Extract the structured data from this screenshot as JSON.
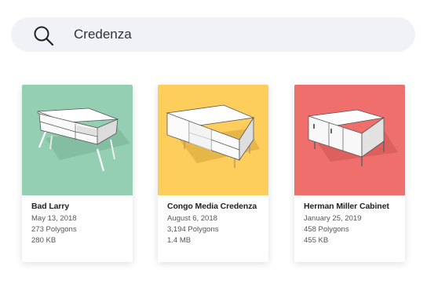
{
  "search": {
    "query": "Credenza",
    "icon": "search-icon"
  },
  "colors": {
    "search_bg": "#f1f2f6",
    "card1_thumb": "#94cfb3",
    "card2_thumb": "#fece5d",
    "card3_thumb": "#ef6f6d"
  },
  "results": [
    {
      "title": "Bad Larry",
      "date": "May 13, 2018",
      "polygons": "273 Polygons",
      "size": "280 KB"
    },
    {
      "title": "Congo Media Credenza",
      "date": "August 6, 2018",
      "polygons": "3,194 Polygons",
      "size": "1.4 MB"
    },
    {
      "title": "Herman Miller Cabinet",
      "date": "January 25, 2019",
      "polygons": "458 Polygons",
      "size": "455 KB"
    }
  ]
}
